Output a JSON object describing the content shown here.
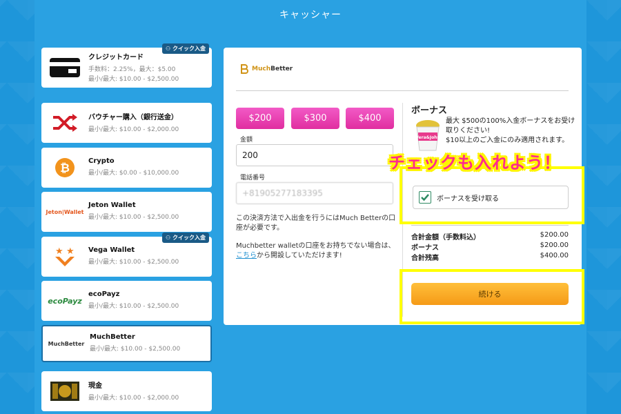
{
  "header": {
    "title": "キャッシャー"
  },
  "quick_badge": "クイック入金",
  "methods": [
    {
      "name": "クレジットカード",
      "line1": "手数料：2.25%，最大：$5.00",
      "line2": "最小/最大: $10.00 - $2,500.00",
      "icon": "credit-card-icon",
      "quick": true
    },
    {
      "name": "バウチャー購入（銀行送金）",
      "line1": "最小/最大: $10.00 - $2,000.00",
      "line2": "",
      "icon": "shuffle-icon",
      "quick": false
    },
    {
      "name": "Crypto",
      "line1": "最小/最大: $0.00 - $10,000.00",
      "line2": "",
      "icon": "bitcoin-icon",
      "quick": false
    },
    {
      "name": "Jeton Wallet",
      "line1": "最小/最大: $10.00 - $2,500.00",
      "line2": "",
      "icon": "jeton-wallet-logo",
      "logo_text": "Jeton|Wallet",
      "quick": false
    },
    {
      "name": "Vega Wallet",
      "line1": "最小/最大: $10.00 - $2,500.00",
      "line2": "",
      "icon": "vega-wallet-logo",
      "quick": true
    },
    {
      "name": "ecoPayz",
      "line1": "最小/最大: $10.00 - $2,500.00",
      "line2": "",
      "icon": "ecopayz-logo",
      "logo_text": "ecoPayz",
      "quick": false
    },
    {
      "name": "MuchBetter",
      "line1": "最小/最大: $10.00 - $2,500.00",
      "line2": "",
      "icon": "muchbetter-logo",
      "logo_text": "MuchBetter",
      "quick": false,
      "active": true
    },
    {
      "name": "現金",
      "line1": "最小/最大: $10.00 - $2,000.00",
      "line2": "",
      "icon": "cash-icon",
      "quick": false
    }
  ],
  "panel": {
    "logo_text_a": "Much",
    "logo_text_b": "Better",
    "amount_buttons": [
      "$200",
      "$300",
      "$400"
    ],
    "amount_label": "金額",
    "amount_value": "200",
    "phone_label": "電話番号",
    "phone_value": "+81905277183395",
    "note1": "この決済方法で入出金を行うにはMuch Betterの口座が必要です。",
    "note2_a": "Muchbetter walletの口座をお持ちでない場合は、",
    "note2_link": "こちら",
    "note2_b": "から開設していただけます!",
    "bonus_title": "ボーナス",
    "bonus_line1": "最大 $500の100%入金ボーナスをお受け取りください!",
    "bonus_line2": "$10以上のご入金にのみ適用されます。",
    "cup_text": "Vera&John",
    "bonus_checkbox_label": "ボーナスを受け取る",
    "bonus_checked": true,
    "summary": [
      {
        "label": "合計金額（手数料込）",
        "value": "$200.00"
      },
      {
        "label": "ボーナス",
        "value": "$200.00"
      },
      {
        "label": "合計残高",
        "value": "$400.00"
      }
    ],
    "continue_label": "続ける"
  },
  "annotation": {
    "callout": "チェックも入れよう！",
    "highlight_color": "#ffff00"
  }
}
